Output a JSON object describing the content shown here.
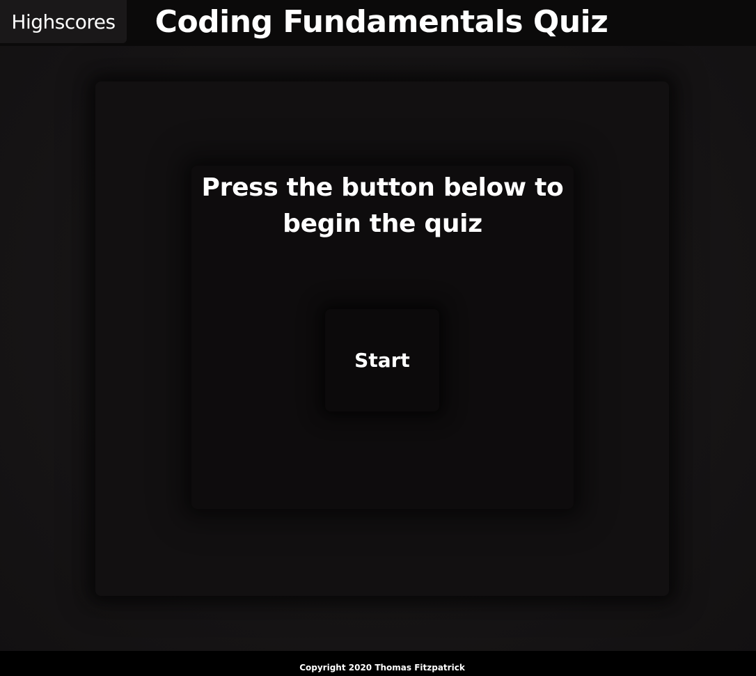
{
  "header": {
    "highscores_label": "Highscores",
    "title": "Coding Fundamentals Quiz"
  },
  "main": {
    "prompt": "Press the button below to begin the quiz",
    "start_label": "Start"
  },
  "footer": {
    "copyright": "Copyright 2020 Thomas Fitzpatrick"
  },
  "colors": {
    "background": "#141213",
    "header_background": "#0b0a0a",
    "panel_background": "#121011",
    "text": "#ffffff"
  }
}
